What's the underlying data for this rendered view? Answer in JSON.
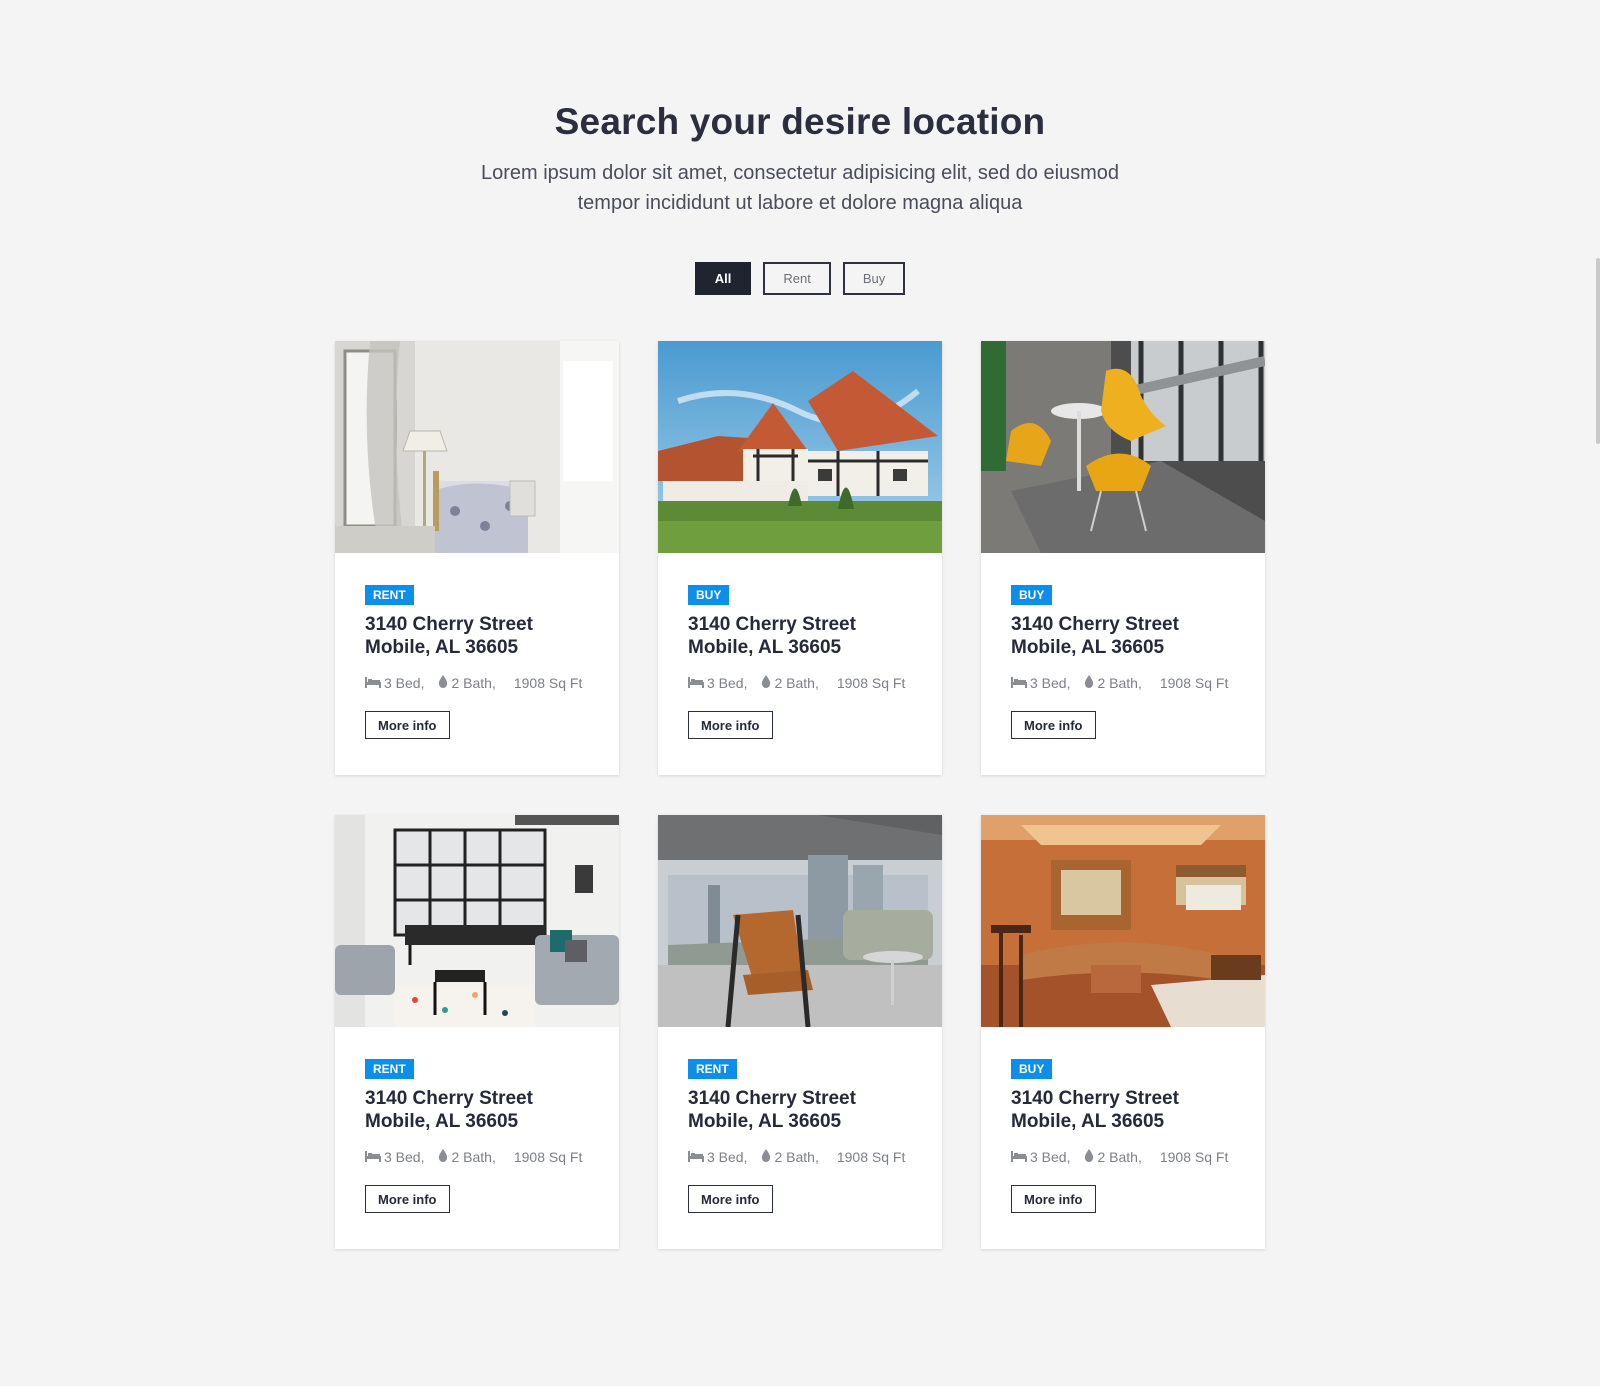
{
  "header": {
    "title": "Search your desire location",
    "subtitle": "Lorem ipsum dolor sit amet, consectetur adipisicing elit, sed do eiusmod tempor incididunt ut labore et dolore magna aliqua"
  },
  "filters": {
    "all": "All",
    "rent": "Rent",
    "buy": "Buy",
    "active": "All"
  },
  "colors": {
    "accent": "#0d8eea",
    "dark": "#1f2430"
  },
  "listings": [
    {
      "badge": "RENT",
      "line1": "3140 Cherry Street",
      "line2": "Mobile, AL 36605",
      "beds": "3 Bed,",
      "baths": "2 Bath,",
      "area": "1908 Sq Ft",
      "button": "More info",
      "photo": "bedroom"
    },
    {
      "badge": "BUY",
      "line1": "3140 Cherry Street",
      "line2": "Mobile, AL 36605",
      "beds": "3 Bed,",
      "baths": "2 Bath,",
      "area": "1908 Sq Ft",
      "button": "More info",
      "photo": "house-exterior"
    },
    {
      "badge": "BUY",
      "line1": "3140 Cherry Street",
      "line2": "Mobile, AL 36605",
      "beds": "3 Bed,",
      "baths": "2 Bath,",
      "area": "1908 Sq Ft",
      "button": "More info",
      "photo": "yellow-chairs"
    },
    {
      "badge": "RENT",
      "line1": "3140 Cherry Street",
      "line2": "Mobile, AL 36605",
      "beds": "3 Bed,",
      "baths": "2 Bath,",
      "area": "1908 Sq Ft",
      "button": "More info",
      "photo": "living-dining"
    },
    {
      "badge": "RENT",
      "line1": "3140 Cherry Street",
      "line2": "Mobile, AL 36605",
      "beds": "3 Bed,",
      "baths": "2 Bath,",
      "area": "1908 Sq Ft",
      "button": "More info",
      "photo": "city-view-lounge"
    },
    {
      "badge": "BUY",
      "line1": "3140 Cherry Street",
      "line2": "Mobile, AL 36605",
      "beds": "3 Bed,",
      "baths": "2 Bath,",
      "area": "1908 Sq Ft",
      "button": "More info",
      "photo": "orange-lounge"
    }
  ]
}
